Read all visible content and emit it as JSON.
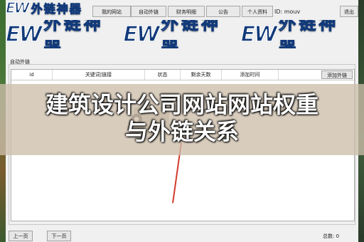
{
  "brand": {
    "logo_latin": "EW",
    "logo_cn": "外链神器"
  },
  "menu": {
    "items": [
      "我的网站",
      "自动外链",
      "财务明细",
      "公告",
      "个人资料"
    ],
    "user_id": "ID: mouv",
    "exit_label": "退出"
  },
  "panel": {
    "title": "自动外链",
    "columns": [
      "id",
      "关键词|链接",
      "状态",
      "剩余天数",
      "添加时间"
    ],
    "add_button": "添加外链"
  },
  "overlay": {
    "title_line1": "建筑设计公司网站网站权重",
    "title_line2": "与外链关系"
  },
  "footer": {
    "prev_label": "上一页",
    "next_label": "下一页",
    "total_label": "总数: 0"
  },
  "colors": {
    "accent_line": "#d23b2b",
    "logo_blue": "#123a7a"
  }
}
